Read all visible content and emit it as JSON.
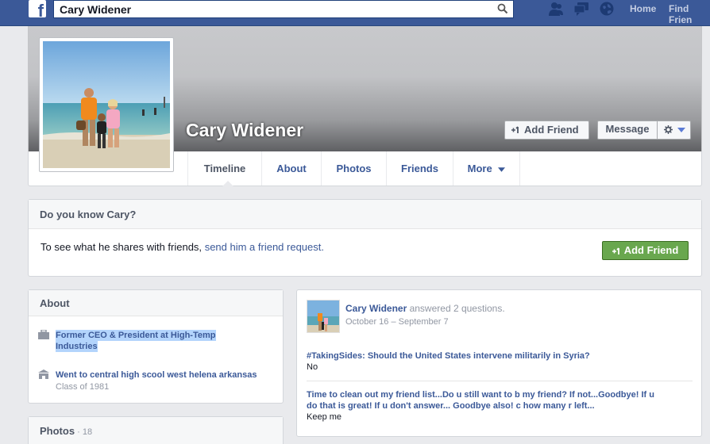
{
  "topbar": {
    "logo_letter": "f",
    "search_value": "Cary Widener",
    "search_icon": "search-icon",
    "jewels": [
      "friend-requests-icon",
      "messages-icon",
      "notifications-icon"
    ],
    "links": [
      "Home",
      "Find Frien"
    ]
  },
  "profile": {
    "name": "Cary Widener",
    "add_friend_label": "Add Friend",
    "message_label": "Message"
  },
  "nav": {
    "tabs": [
      "Timeline",
      "About",
      "Photos",
      "Friends",
      "More"
    ],
    "active": "Timeline"
  },
  "know_box": {
    "title": "Do you know Cary?",
    "text": "To see what he shares with friends,",
    "link": "send him a friend request.",
    "button": "Add Friend"
  },
  "about": {
    "title": "About",
    "work": {
      "line1": "Former CEO & President at High-Temp",
      "line2": "Industries"
    },
    "education": {
      "line": "Went to central high scool west helena arkansas",
      "sub": "Class of 1981"
    }
  },
  "photos_card": {
    "title": "Photos",
    "count": " · 18"
  },
  "post": {
    "author": "Cary Widener",
    "action": " answered 2 questions.",
    "date": "October 16 – September 7",
    "qa": [
      {
        "question": "#TakingSides: Should the United States intervene militarily in Syria?",
        "answer": "No"
      },
      {
        "question_line1": "Time to clean out my friend list...Do u still want to b my friend? If not...Goodbye! If u",
        "question_line2": "do that is great! If u don't answer... Goodbye also! c how many r left...",
        "answer": "Keep me"
      }
    ]
  },
  "colors": {
    "facebook_blue": "#3b5998",
    "green_button": "#69a74e",
    "page_bg": "#e9eaed"
  }
}
